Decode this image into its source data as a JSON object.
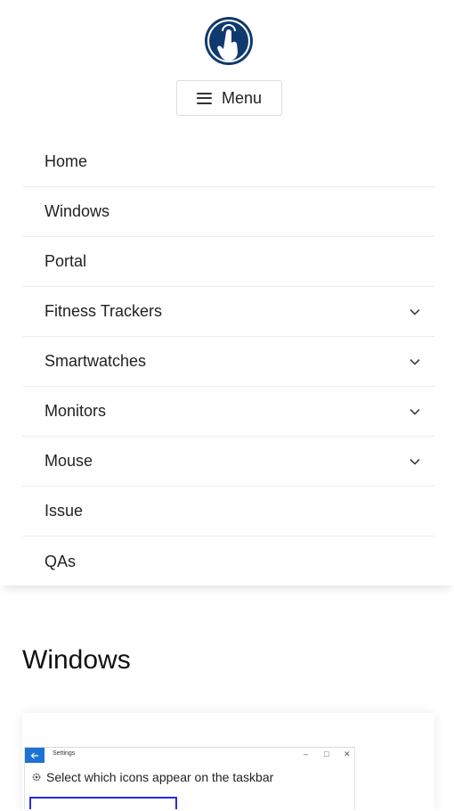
{
  "header": {
    "logo_icon": "hand-pointer-icon",
    "menu_button": {
      "icon": "hamburger-icon",
      "label": "Menu"
    }
  },
  "nav": {
    "items": [
      {
        "label": "Home",
        "has_submenu": false
      },
      {
        "label": "Windows",
        "has_submenu": false
      },
      {
        "label": "Portal",
        "has_submenu": false
      },
      {
        "label": "Fitness Trackers",
        "has_submenu": true
      },
      {
        "label": "Smartwatches",
        "has_submenu": true
      },
      {
        "label": "Monitors",
        "has_submenu": true
      },
      {
        "label": "Mouse",
        "has_submenu": true
      },
      {
        "label": "Issue",
        "has_submenu": false
      },
      {
        "label": "QAs",
        "has_submenu": false
      }
    ]
  },
  "main": {
    "section_title": "Windows",
    "article_card": {
      "thumbnail": {
        "window_title": "Settings",
        "back_icon": "arrow-left-icon",
        "window_controls": [
          "–",
          "□",
          "✕"
        ],
        "setting_icon": "gear-icon",
        "setting_text": "Select which icons appear on the taskbar"
      }
    }
  },
  "colors": {
    "logo_blue": "#0f3a6e",
    "text": "#222222",
    "divider": "#ececec",
    "windows_accent": "#1e73d2",
    "highlight_border": "#2b2bd9"
  }
}
